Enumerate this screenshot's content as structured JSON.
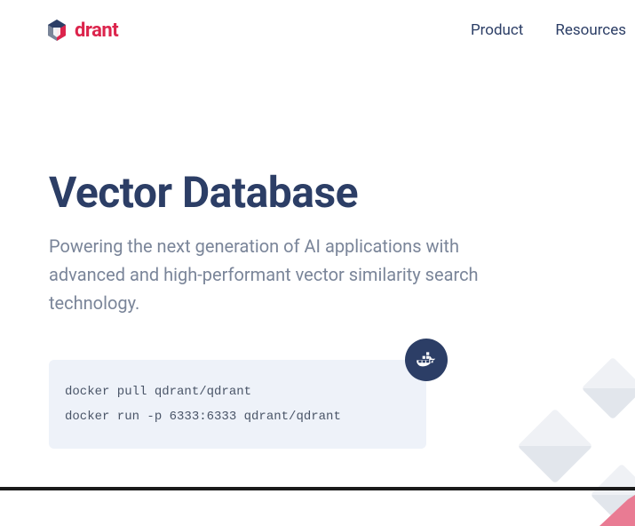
{
  "brand": {
    "name": "drant"
  },
  "nav": {
    "items": [
      {
        "label": "Product"
      },
      {
        "label": "Resources"
      }
    ]
  },
  "hero": {
    "title": "Vector Database",
    "subtitle": "Powering the next generation of AI applications with advanced and high-performant vector similarity search technology."
  },
  "code": {
    "lines": [
      "docker pull qdrant/qdrant",
      "docker run -p 6333:6333 qdrant/qdrant"
    ]
  }
}
